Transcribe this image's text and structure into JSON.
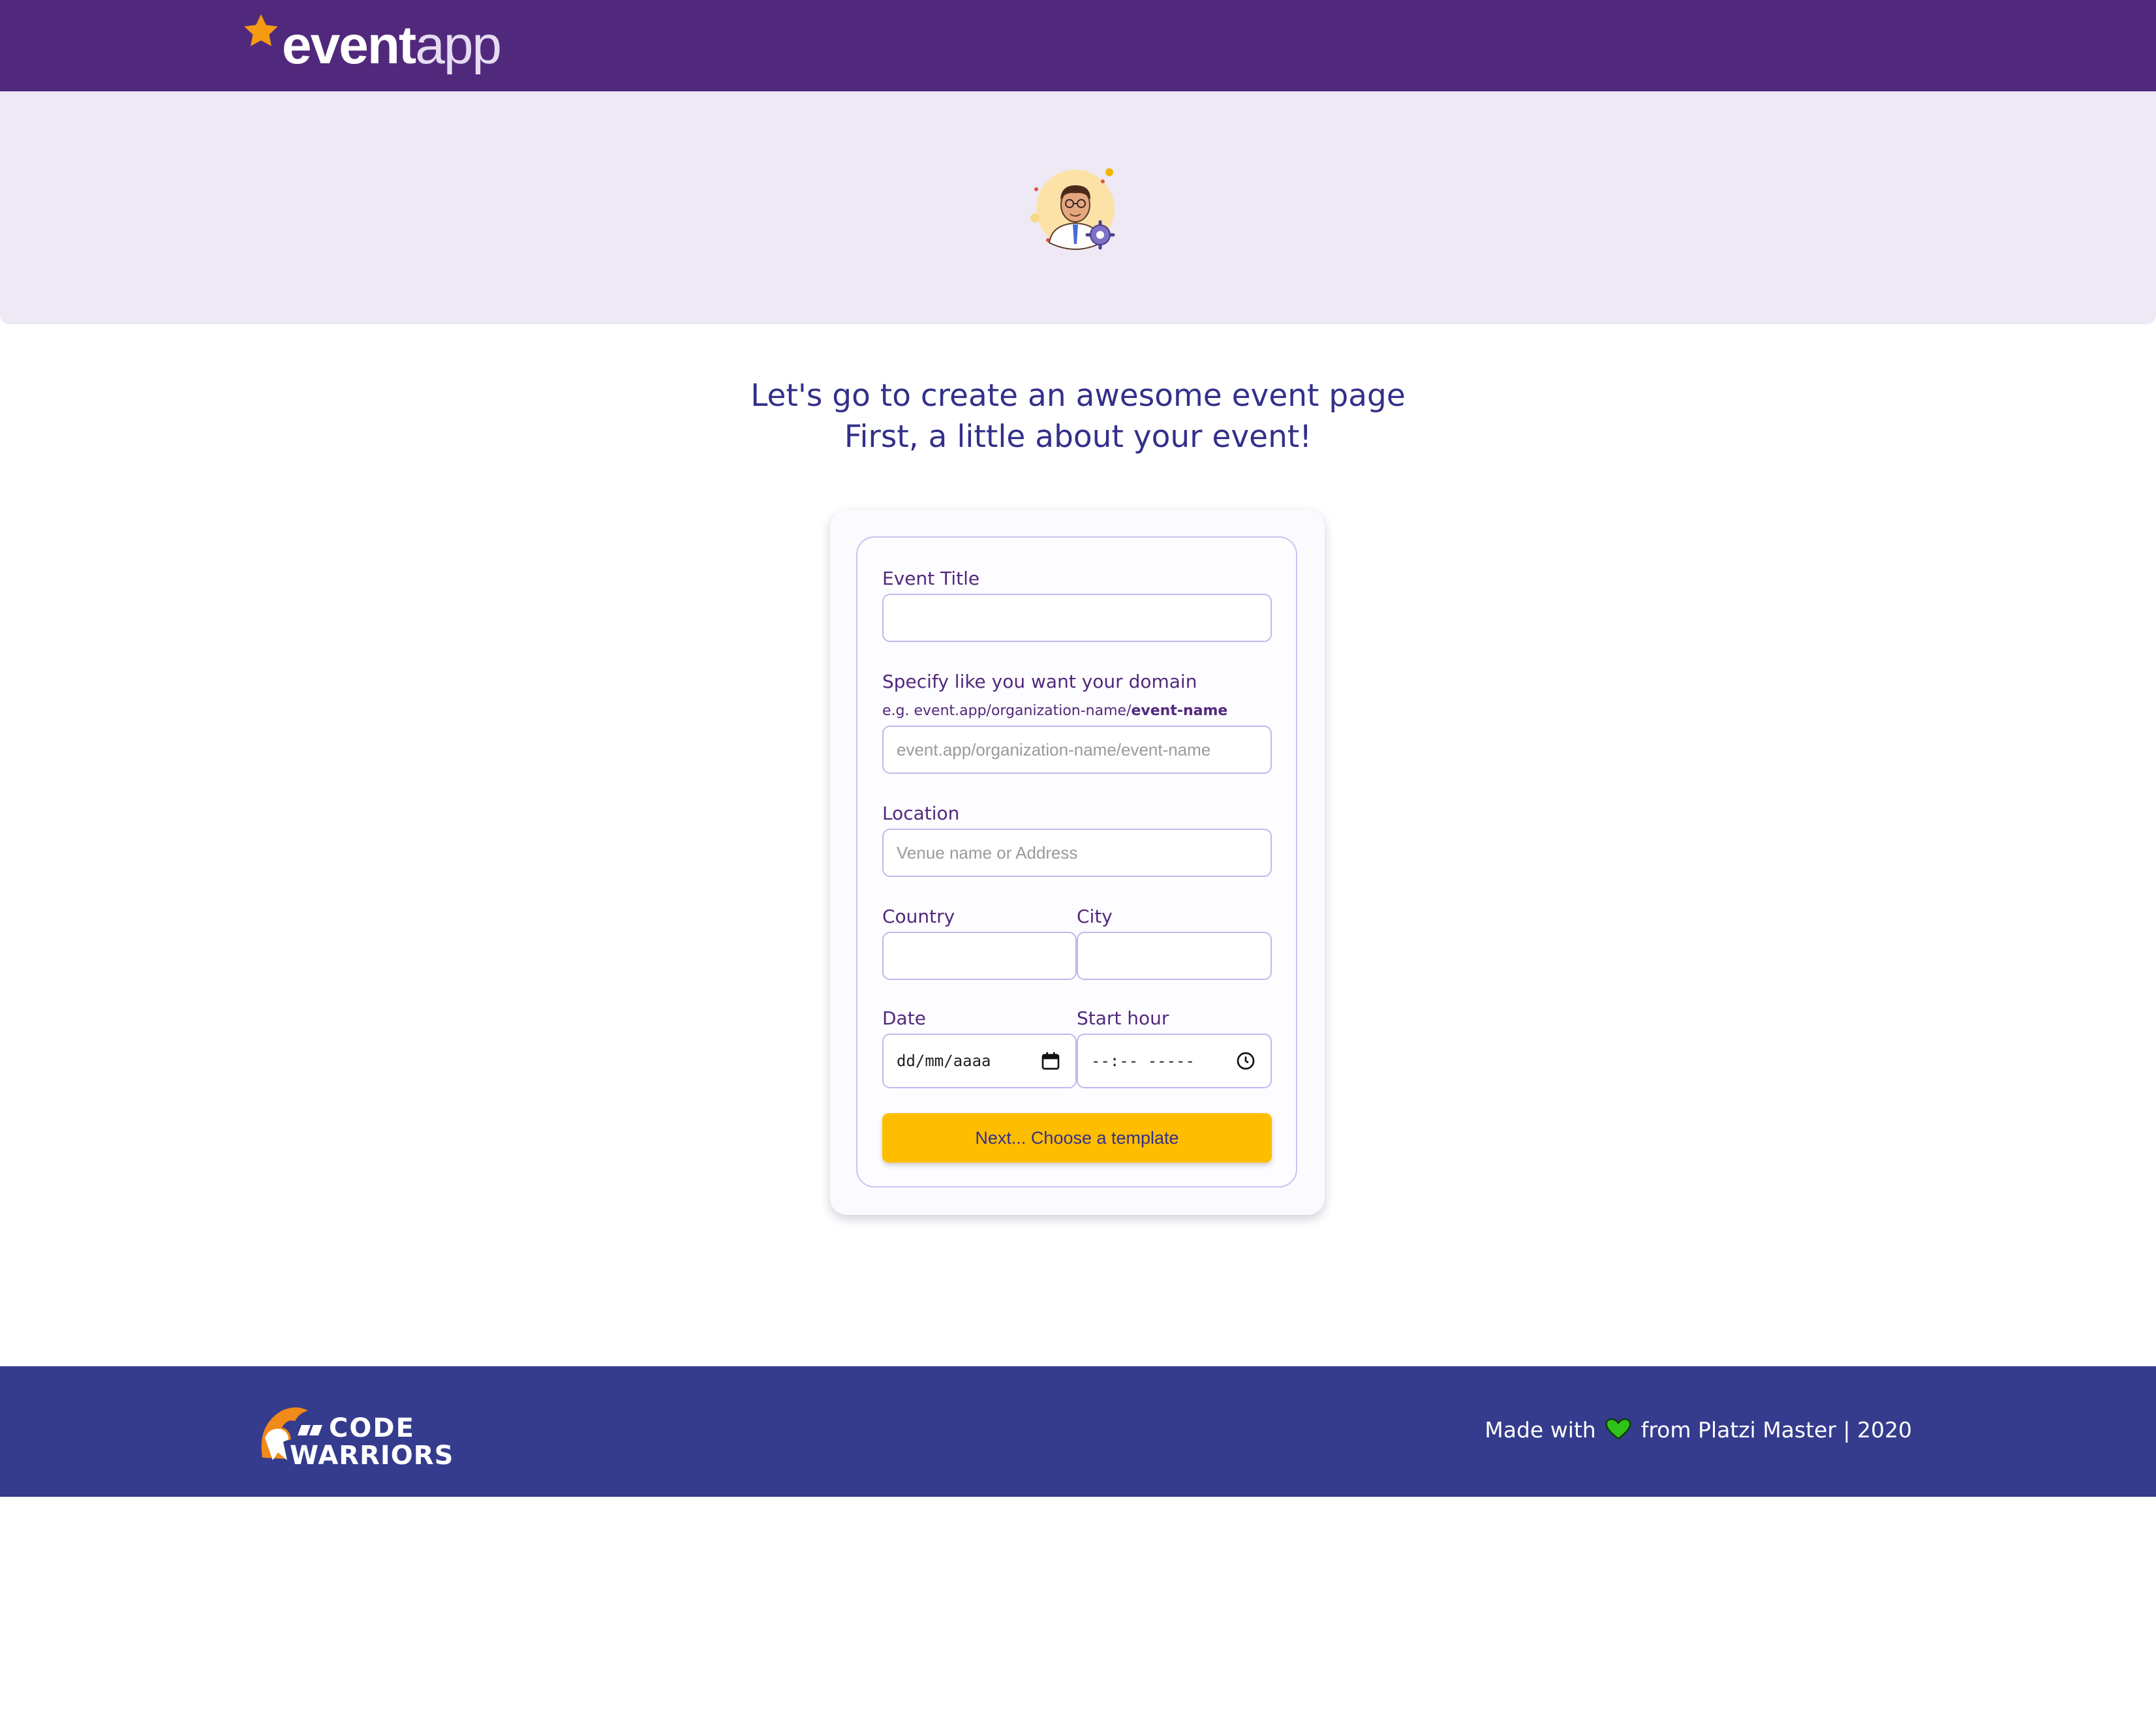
{
  "header": {
    "brand_bold": "event",
    "brand_light": "app",
    "colors": {
      "bar": "#51297c",
      "star": "#f59a12"
    }
  },
  "hero": {
    "avatar_icon": "user-gear-avatar-icon",
    "background": "#eee9f5"
  },
  "intro": {
    "line1": "Let's go to create an awesome event page",
    "line2": "First, a little about your event!"
  },
  "form": {
    "event_title": {
      "label": "Event Title",
      "value": "",
      "placeholder": ""
    },
    "domain": {
      "label": "Specify like you want your domain",
      "hint_prefix": "e.g. event.app/organization-name/",
      "hint_bold": "event-name",
      "placeholder": "event.app/organization-name/event-name"
    },
    "location": {
      "label": "Location",
      "placeholder": "Venue name or Address"
    },
    "country": {
      "label": "Country",
      "value": ""
    },
    "city": {
      "label": "City",
      "value": ""
    },
    "date": {
      "label": "Date",
      "display": "dd/mm/aaaa",
      "icon": "calendar-icon"
    },
    "start_hour": {
      "label": "Start hour",
      "display": "--:-- -----",
      "icon": "clock-icon"
    },
    "next_button": "Next... Choose a template",
    "colors": {
      "label": "#51297c",
      "border": "#bdb9ef",
      "button": "#ffbd00"
    }
  },
  "footer": {
    "logo_top": "CODE",
    "logo_bottom": "WARRIORS",
    "made_prefix": "Made with",
    "made_suffix": "from Platzi Master | 2020",
    "heart_icon": "green-heart-icon",
    "colors": {
      "background": "#353c8d",
      "logo_accent": "#f08a18",
      "heart": "#2fc21a"
    }
  }
}
